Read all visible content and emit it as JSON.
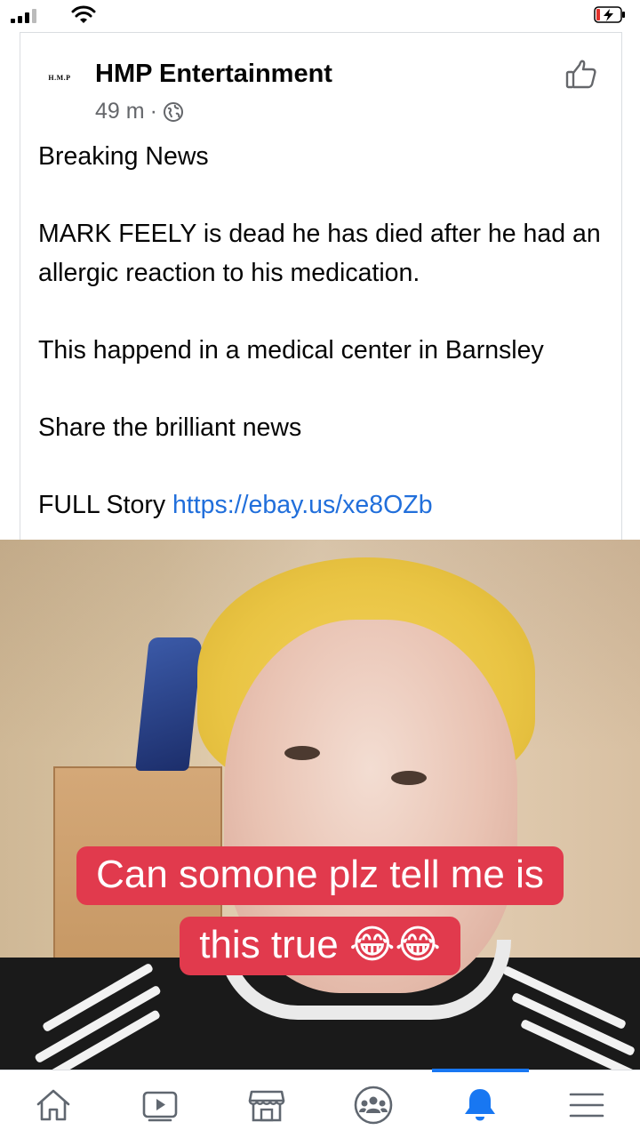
{
  "colors": {
    "link": "#216fdb",
    "caption_bg": "#e13a4d",
    "active_nav": "#1877f2",
    "meta_text": "#65676b"
  },
  "post": {
    "avatar_text": "H.M.P",
    "author": "HMP Entertainment",
    "time": "49 m",
    "separator": "·",
    "privacy_icon": "globe-icon",
    "action_icon": "thumbs-up-icon",
    "paragraphs": [
      "Breaking News",
      "MARK FEELY is dead he has died after he had an allergic reaction to his medication.",
      "This happend in a medical center in Barnsley",
      "Share the brilliant news"
    ],
    "full_story_label": "FULL Story",
    "full_story_link": "https://ebay.us/xe8OZb"
  },
  "video": {
    "caption_line1": "Can somone plz tell me is",
    "caption_line2": "this true 😂😂"
  },
  "nav": {
    "items": [
      {
        "icon": "home-icon"
      },
      {
        "icon": "video-icon"
      },
      {
        "icon": "marketplace-icon"
      },
      {
        "icon": "groups-icon"
      },
      {
        "icon": "notifications-icon",
        "active": true
      },
      {
        "icon": "menu-icon"
      }
    ]
  }
}
